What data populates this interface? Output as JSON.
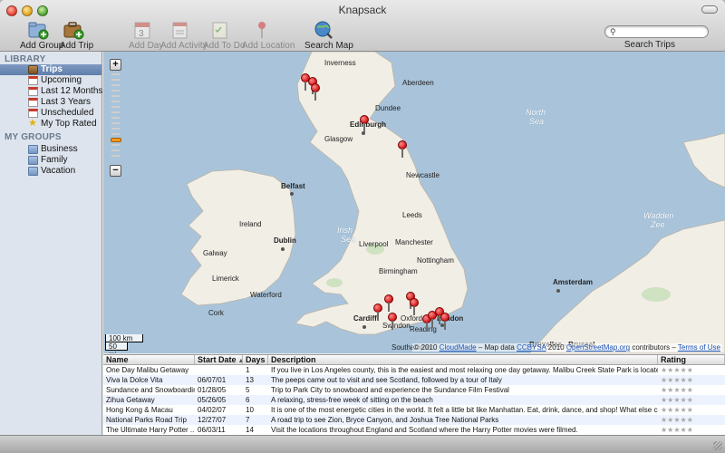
{
  "window": {
    "title": "Knapsack"
  },
  "toolbar": {
    "items": [
      {
        "label": "Add Group",
        "icon": "add-group-icon"
      },
      {
        "label": "Add Trip",
        "icon": "add-trip-icon"
      },
      {
        "label": "Add Day",
        "icon": "add-day-icon"
      },
      {
        "label": "Add Activity",
        "icon": "add-activity-icon"
      },
      {
        "label": "Add To Do",
        "icon": "add-todo-icon"
      },
      {
        "label": "Add Location",
        "icon": "add-location-icon"
      },
      {
        "label": "Search Map",
        "icon": "search-map-icon"
      }
    ],
    "search": {
      "value": "",
      "placeholder": "",
      "label": "Search Trips"
    }
  },
  "sidebar": {
    "library_heading": "LIBRARY",
    "library": [
      {
        "label": "Trips",
        "icon": "trips-icon",
        "selected": true
      },
      {
        "label": "Upcoming",
        "icon": "calendar-icon"
      },
      {
        "label": "Last 12 Months",
        "icon": "calendar-icon"
      },
      {
        "label": "Last 3 Years",
        "icon": "calendar-icon"
      },
      {
        "label": "Unscheduled",
        "icon": "calendar-icon"
      },
      {
        "label": "My Top Rated",
        "icon": "star-icon"
      }
    ],
    "groups_heading": "MY GROUPS",
    "groups": [
      {
        "label": "Business",
        "icon": "folder-icon"
      },
      {
        "label": "Family",
        "icon": "folder-icon"
      },
      {
        "label": "Vacation",
        "icon": "folder-icon"
      }
    ]
  },
  "map": {
    "zoom_in": "+",
    "zoom_out": "−",
    "scale_km": "100 km",
    "scale_mi": "50 mi",
    "attribution": {
      "prefix": "© 2010",
      "cloudmade": "CloudMade",
      "middle": "– Map data",
      "ccbysa": "CCBYSA",
      "year": "2010",
      "osm": "OpenStreetMap.org",
      "contributors": "contributors –",
      "terms": "Terms of Use"
    },
    "labels": {
      "inverness": "Inverness",
      "aberdeen": "Aberdeen",
      "dundee": "Dundee",
      "edinburgh": "Edinburgh",
      "glasgow": "Glasgow",
      "north_sea_1": "North",
      "north_sea_2": "Sea",
      "belfast": "Belfast",
      "dublin": "Dublin",
      "irish_sea_1": "Irish",
      "irish_sea_2": "Sea",
      "ireland": "Ireland",
      "galway": "Galway",
      "limerick": "Limerick",
      "waterford": "Waterford",
      "cork": "Cork",
      "cardiff": "Cardiff",
      "london": "London",
      "amsterdam": "Amsterdam",
      "wadden_1": "Wadden",
      "wadden_2": "Zee",
      "liverpool": "Liverpool",
      "leeds": "Leeds",
      "manchester": "Manchester",
      "newcastle": "Newcastle",
      "nottingham": "Nottingham",
      "birmingham": "Birmingham",
      "oxford": "Oxford",
      "swindon": "Swindon",
      "reading": "Reading",
      "southampton": "Southampton",
      "brussels": "Bruxelles - Brussel"
    }
  },
  "table": {
    "columns": [
      "Name",
      "Start Date",
      "Days",
      "Description",
      "Rating"
    ],
    "sort_indicator": "▲",
    "rows": [
      {
        "name": "One Day Malibu Getaway",
        "start": "",
        "days": "1",
        "desc": "If you live in Los Angeles county, this is the easiest and most relaxing one day getaway. Malibu Creek State Park is located onl...",
        "rating": "★★★★★"
      },
      {
        "name": "Viva la Dolce Vita",
        "start": "06/07/01",
        "days": "13",
        "desc": "The peeps came out to visit and see Scotland, followed by a tour of Italy",
        "rating": "★★★★★"
      },
      {
        "name": "Sundance and Snowboarding",
        "start": "01/28/05",
        "days": "5",
        "desc": "Trip to Park City to snowboard and experience the Sundance Film Festival",
        "rating": "★★★★★"
      },
      {
        "name": "Zihua Getaway",
        "start": "05/26/05",
        "days": "6",
        "desc": "A relaxing, stress-free week of sitting on the beach",
        "rating": "★★★★★"
      },
      {
        "name": "Hong Kong & Macau",
        "start": "04/02/07",
        "days": "10",
        "desc": "It is one of the most energetic cities in the world. It felt a little bit like Manhattan. Eat, drink, dance, and shop! What else can ...",
        "rating": "★★★★★"
      },
      {
        "name": "National Parks Road Trip",
        "start": "12/27/07",
        "days": "7",
        "desc": "A road trip to see Zion, Bryce Canyon, and Joshua Tree National Parks",
        "rating": "★★★★★"
      },
      {
        "name": "The Ultimate Harry Potter ...",
        "start": "06/03/11",
        "days": "14",
        "desc": "Visit the locations throughout England and Scotland where the Harry Potter movies were filmed.",
        "rating": "★★★★★"
      }
    ]
  },
  "colors": {
    "sea": "#a9c4da",
    "land": "#f0ede5",
    "selection": "#6a87b3",
    "pin": "#d11616"
  }
}
